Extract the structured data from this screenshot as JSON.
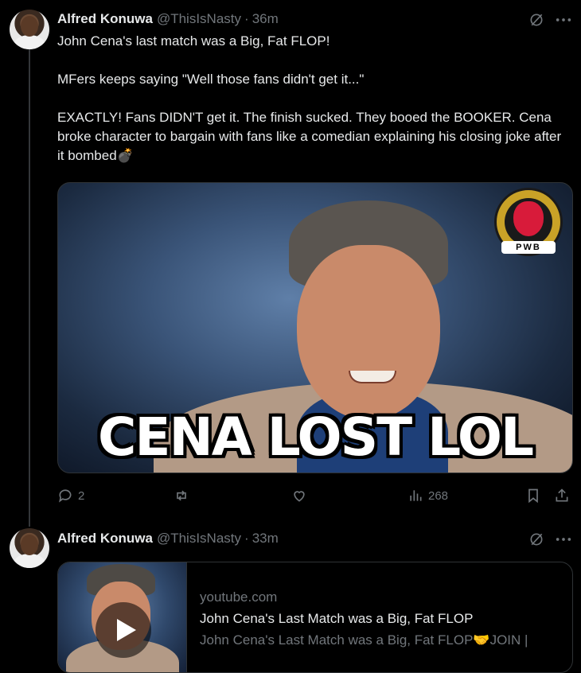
{
  "tweets": [
    {
      "author_name": "Alfred Konuwa",
      "handle": "@ThisIsNasty",
      "separator": "·",
      "time": "36m",
      "text_lines": [
        "John Cena's last match was a Big, Fat FLOP!",
        "MFers keeps saying \"Well those fans didn't get it...\"",
        "EXACTLY! Fans DIDN'T get it. The finish sucked. They booed the BOOKER. Cena broke character to bargain with fans like a comedian explaining his closing joke after it bombed💣"
      ],
      "media": {
        "caption": "CENA LOST LOL",
        "logo_text": "PWB"
      },
      "actions": {
        "replies": "2",
        "reposts": "",
        "likes": "",
        "views": "268"
      }
    },
    {
      "author_name": "Alfred Konuwa",
      "handle": "@ThisIsNasty",
      "separator": "·",
      "time": "33m",
      "link_card": {
        "domain": "youtube.com",
        "title": "John Cena's Last Match was a Big, Fat FLOP",
        "description": "John Cena's Last Match was a Big, Fat FLOP🤝JOIN |"
      }
    }
  ],
  "icons": {
    "grok": "grok-icon",
    "more": "more-icon",
    "reply": "reply-icon",
    "repost": "repost-icon",
    "like": "heart-icon",
    "views": "views-icon",
    "bookmark": "bookmark-icon",
    "share": "share-icon",
    "play": "play-icon"
  },
  "colors": {
    "background": "#000000",
    "text": "#e7e9ea",
    "muted": "#71767b",
    "border": "#2f3336"
  }
}
